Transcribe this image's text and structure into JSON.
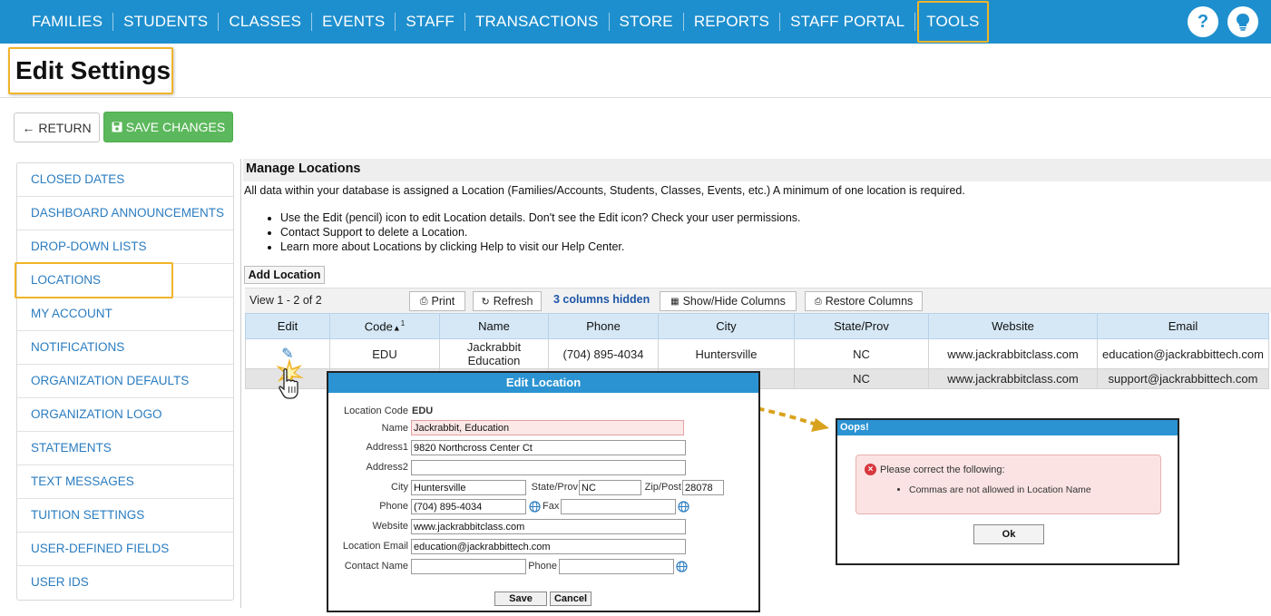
{
  "nav": {
    "items": [
      "FAMILIES",
      "STUDENTS",
      "CLASSES",
      "EVENTS",
      "STAFF",
      "TRANSACTIONS",
      "STORE",
      "REPORTS",
      "STAFF PORTAL",
      "TOOLS"
    ],
    "help_icon": "?",
    "tips_icon": "lightbulb-icon"
  },
  "page": {
    "title": "Edit Settings"
  },
  "actions": {
    "return_label": "RETURN",
    "save_label": "SAVE CHANGES"
  },
  "sidebar": {
    "items": [
      "CLOSED DATES",
      "DASHBOARD ANNOUNCEMENTS",
      "DROP-DOWN LISTS",
      "LOCATIONS",
      "MY ACCOUNT",
      "NOTIFICATIONS",
      "ORGANIZATION DEFAULTS",
      "ORGANIZATION LOGO",
      "STATEMENTS",
      "TEXT MESSAGES",
      "TUITION SETTINGS",
      "USER-DEFINED FIELDS",
      "USER IDS"
    ],
    "selected": "LOCATIONS"
  },
  "main": {
    "heading": "Manage Locations",
    "intro": "All data within your database is assigned a Location (Families/Accounts, Students, Classes, Events, etc.) A minimum of one location is required.",
    "bullets": [
      "Use the Edit (pencil) icon to edit Location details. Don't see the Edit icon? Check your user permissions.",
      "Contact Support to delete a Location.",
      "Learn more about Locations by clicking Help to visit our Help Center."
    ],
    "add_label": "Add Location"
  },
  "toolbar": {
    "view_count": "View 1 - 2 of 2",
    "print": "Print",
    "refresh": "Refresh",
    "hidden": "3 columns hidden",
    "show_hide": "Show/Hide Columns",
    "restore": "Restore Columns"
  },
  "table": {
    "headers": [
      "Edit",
      "Code",
      "Name",
      "Phone",
      "City",
      "State/Prov",
      "Website",
      "Email"
    ],
    "sort_indicator": "1",
    "rows": [
      {
        "code": "EDU",
        "name_line1": "Jackrabbit",
        "name_line2": "Education",
        "phone": "(704) 895-4034",
        "city": "Huntersville",
        "state": "NC",
        "website": "www.jackrabbitclass.com",
        "email": "education@jackrabbittech.com"
      },
      {
        "code": "",
        "name_line1": "",
        "name_line2": "",
        "phone": "",
        "city": "",
        "state": "NC",
        "website": "www.jackrabbitclass.com",
        "email": "support@jackrabbittech.com"
      }
    ]
  },
  "edit_dialog": {
    "title": "Edit Location",
    "code_label": "Location Code",
    "code_value": "EDU",
    "name_label": "Name",
    "name_value": "Jackrabbit, Education",
    "address1_label": "Address1",
    "address1_value": "9820 Northcross Center Ct",
    "address2_label": "Address2",
    "address2_value": "",
    "city_label": "City",
    "city_value": "Huntersville",
    "state_label": "State/Prov",
    "state_value": "NC",
    "zip_label": "Zip/Post",
    "zip_value": "28078",
    "phone_label": "Phone",
    "phone_value": "(704) 895-4034",
    "fax_label": "Fax",
    "fax_value": "",
    "website_label": "Website",
    "website_value": "www.jackrabbitclass.com",
    "email_label": "Location Email",
    "email_value": "education@jackrabbittech.com",
    "contact_label": "Contact Name",
    "contact_value": "",
    "contact_phone_label": "Phone",
    "contact_phone_value": "",
    "save_label": "Save",
    "cancel_label": "Cancel"
  },
  "error_dialog": {
    "title": "Oops!",
    "heading": "Please correct the following:",
    "items": [
      "Commas are not allowed in Location Name"
    ],
    "ok_label": "Ok"
  },
  "colors": {
    "nav": "#1e8fce",
    "highlight": "#f0b429",
    "save": "#5cb85c",
    "link": "#2a7cc0",
    "dialog_title": "#2b93d2"
  }
}
